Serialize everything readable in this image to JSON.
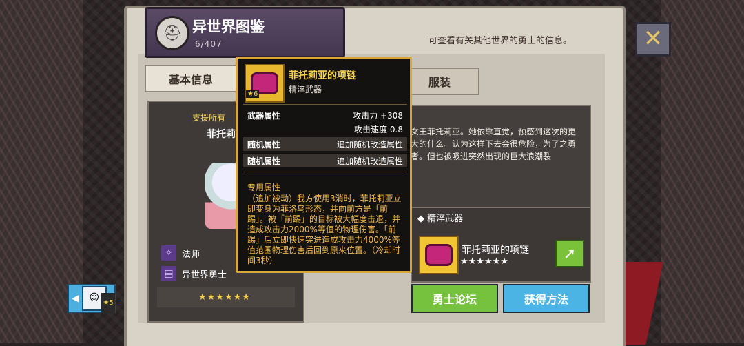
{
  "header": {
    "title": "异世界图鉴",
    "count": "6/407"
  },
  "subtitle": "可查看有关其他世界的勇士的信息。",
  "tabs": [
    {
      "label": "基本信息"
    },
    {
      "label": "服装"
    }
  ],
  "character": {
    "banner": "支援所有",
    "name": "菲托莉亚",
    "role": "法师",
    "faction": "异世界勇士",
    "stars": "★★★★★★"
  },
  "description": "女王菲托莉亚。她依靠直觉，预感到这次的更大的什么。认为这样下去会很危险，为了之勇者。但也被吸进突然出现的巨大浪潮裂",
  "weapon": {
    "section_label": "精淬武器",
    "name": "菲托莉亚的项链",
    "stars": "★★★★★★"
  },
  "buttons": {
    "forum": "勇士论坛",
    "obtain": "获得方法"
  },
  "side_hero": {
    "level": "5"
  },
  "tooltip": {
    "name": "菲托莉亚的项链",
    "grade": "精淬武器",
    "star_badge": "★6",
    "weapon_attr_label": "武器属性",
    "atk": "攻击力 +308",
    "atk_speed": "攻击速度 0.8",
    "random_label_1": "随机属性",
    "random_value_1": "追加随机改造属性",
    "random_label_2": "随机属性",
    "random_value_2": "追加随机改造属性",
    "exclusive_label": "专用属性",
    "exclusive_text": "（追加被动）我方使用3消时，菲托莉亚立即变身为菲洛鸟形态，并向前方是「前踢」。被「前踢」的目标被大幅度击退，并造成攻击力2000%等值的物理伤害。「前踢」后立即快速突进造成攻击力4000%等值范围物理伤害后回到原来位置。（冷却时间3秒）"
  },
  "colors": {
    "accent": "#d9a53a",
    "green": "#76c23e",
    "blue": "#4bb4e4"
  }
}
